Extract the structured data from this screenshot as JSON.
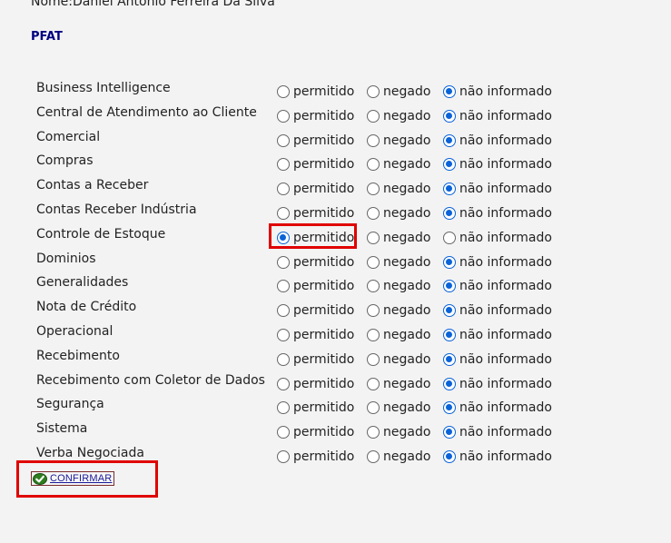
{
  "header": {
    "user_name": "Nome:Daniel Antonio Ferreira Da Silva",
    "section_title": "PFAT"
  },
  "option_labels": {
    "permitido": "permitido",
    "negado": "negado",
    "nao_informado": "não informado"
  },
  "rows": [
    {
      "module": "Business Intelligence",
      "selected": "nao_informado"
    },
    {
      "module": "Central de Atendimento ao Cliente",
      "selected": "nao_informado"
    },
    {
      "module": "Comercial",
      "selected": "nao_informado"
    },
    {
      "module": "Compras",
      "selected": "nao_informado"
    },
    {
      "module": "Contas a Receber",
      "selected": "nao_informado"
    },
    {
      "module": "Contas Receber Indústria",
      "selected": "nao_informado"
    },
    {
      "module": "Controle de Estoque",
      "selected": "permitido"
    },
    {
      "module": "Dominios",
      "selected": "nao_informado"
    },
    {
      "module": "Generalidades",
      "selected": "nao_informado"
    },
    {
      "module": "Nota de Crédito",
      "selected": "nao_informado"
    },
    {
      "module": "Operacional",
      "selected": "nao_informado"
    },
    {
      "module": "Recebimento",
      "selected": "nao_informado"
    },
    {
      "module": "Recebimento com Coletor de Dados",
      "selected": "nao_informado"
    },
    {
      "module": "Segurança",
      "selected": "nao_informado"
    },
    {
      "module": "Sistema",
      "selected": "nao_informado"
    },
    {
      "module": "Verba Negociada",
      "selected": "nao_informado"
    }
  ],
  "confirm": {
    "label": "CONFIRMAR",
    "icon": "check-icon"
  },
  "colors": {
    "highlight": "#e00000",
    "radio_selected": "#0a63d8",
    "title": "#000080"
  }
}
